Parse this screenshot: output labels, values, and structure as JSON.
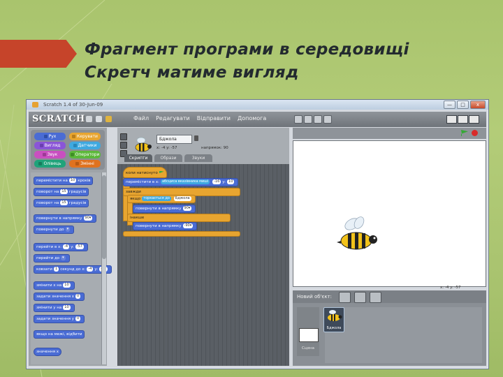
{
  "slide": {
    "title_line1": "Фрагмент програми в середовищі",
    "title_line2": "Скретч матиме вигляд",
    "accent_color": "#c6442a"
  },
  "window": {
    "title": "Scratch 1.4 of 30-Jun-09",
    "buttons": [
      "—",
      "□",
      "x"
    ]
  },
  "scratch_bar": {
    "logo": "SCRATCH",
    "menu": [
      "Файл",
      "Редагувати",
      "Відправити",
      "Допомога"
    ]
  },
  "categories": [
    {
      "label": "Рух",
      "color": "#4a6cd4"
    },
    {
      "label": "Керувати",
      "color": "#e8a530"
    },
    {
      "label": "Вигляд",
      "color": "#8a55d7"
    },
    {
      "label": "Датчики",
      "color": "#3fa9e0"
    },
    {
      "label": "Звук",
      "color": "#c94fc0"
    },
    {
      "label": "Оператори",
      "color": "#5cb83a"
    },
    {
      "label": "Олівець",
      "color": "#1fa37a"
    },
    {
      "label": "Змінні",
      "color": "#e0721f"
    }
  ],
  "palette_blocks": {
    "b1_text": "перемістити на",
    "b1_val": "10",
    "b1_tail": "кроків",
    "b2_text": "поворот на",
    "b2_val": "15",
    "b2_tail": "градусів",
    "b3_text": "поворот на",
    "b3_val": "15",
    "b3_tail": "градусів",
    "b4_text": "повернути в напрямку",
    "b4_val": "90▾",
    "b5_text": "повернути до",
    "b5_val": "▾",
    "b6_text": "перейти в x:",
    "b6_v1": "-4",
    "b6_mid": "y:",
    "b6_v2": "-57",
    "b7_text": "перейти до",
    "b7_val": "▾",
    "b8_text": "ковзати",
    "b8_v1": "1",
    "b8_mid": "секунд до x:",
    "b8_v2": "-4",
    "b8_tail": "y:",
    "b8_v3": "-57",
    "b9_text": "змінити x на",
    "b9_val": "10",
    "b10_text": "задати значення x",
    "b10_val": "0",
    "b11_text": "змінити y на",
    "b11_val": "10",
    "b12_text": "задати значення y",
    "b12_val": "0",
    "b13_text": "якщо на межі, відбити",
    "b14_text": "значення x"
  },
  "sprite_info": {
    "name": "Бджола",
    "coords": "x: -4  y: -57",
    "direction": "напрямок: 90",
    "tabs": [
      "Скрипти",
      "Образи",
      "Звуки"
    ]
  },
  "script": {
    "hat": "коли натиснуто",
    "goto_text": "перемістити в x:",
    "goto_sensor": "абсциса вказівника миші",
    "goto_v1": "-16",
    "goto_y": "y:",
    "goto_v2": "10",
    "forever_label": "завжди",
    "if_label": "якщо",
    "if_cond": "торкається до",
    "if_target": "Бджола",
    "point_text": "повернути в напрямку",
    "point_val": "90▾",
    "else_label": "інакше",
    "point2_text": "повернути в напрямку",
    "point2_val": "-90▾"
  },
  "stage": {
    "coords": "x: -4   y: -57"
  },
  "sprite_panel": {
    "new_sprite_label": "Новий об'єкт:",
    "stage_label": "Сцена",
    "sprite_label": "Бджола"
  }
}
